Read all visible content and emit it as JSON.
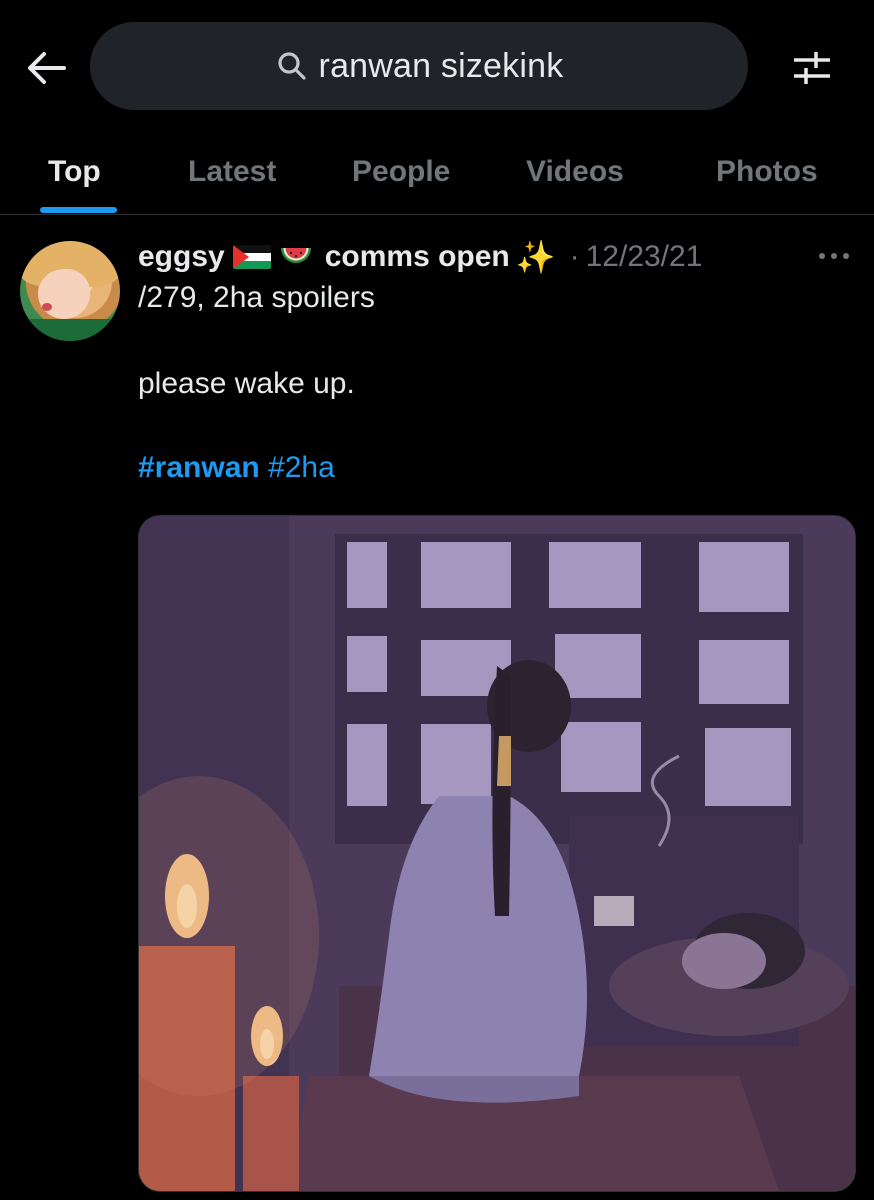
{
  "header": {
    "search": {
      "query": "ranwan sizekink"
    }
  },
  "tabs": [
    {
      "label": "Top",
      "active": true
    },
    {
      "label": "Latest",
      "active": false
    },
    {
      "label": "People",
      "active": false
    },
    {
      "label": "Videos",
      "active": false
    },
    {
      "label": "Photos",
      "active": false
    }
  ],
  "tweet": {
    "display_name": "eggsy",
    "name_suffix": "comms open",
    "date": "12/23/21",
    "name_continuation": "/279, 2ha spoilers",
    "body": "please wake up.",
    "hashtags": [
      "#ranwan",
      "#2ha"
    ],
    "emoji": [
      "palestine-flag-icon",
      "watermelon-icon",
      "sparkles-icon"
    ]
  },
  "colors": {
    "background": "#000000",
    "accent": "#1d9bf0",
    "muted": "#71767b",
    "text": "#e7e9ea",
    "search_bg": "#202327"
  }
}
